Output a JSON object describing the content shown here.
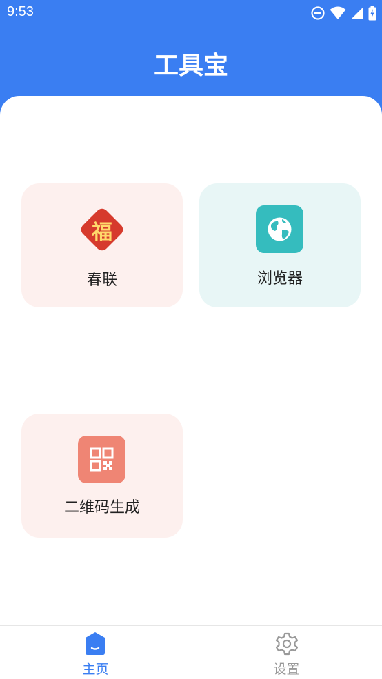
{
  "status_bar": {
    "time": "9:53"
  },
  "header": {
    "title": "工具宝"
  },
  "tools": [
    {
      "label": "春联",
      "icon": "fu-diamond-icon",
      "icon_glyph": "福",
      "card_color": "#fdf0ee",
      "icon_color": "#d63a2c"
    },
    {
      "label": "浏览器",
      "icon": "globe-icon",
      "card_color": "#e8f6f6",
      "icon_color": "#35bcbe"
    },
    {
      "label": "二维码生成",
      "icon": "qr-code-icon",
      "card_color": "#fdf0ee",
      "icon_color": "#ef8574"
    }
  ],
  "bottom_nav": {
    "home": {
      "label": "主页",
      "icon": "home-icon",
      "active": true,
      "color": "#3a7ef2"
    },
    "settings": {
      "label": "设置",
      "icon": "gear-icon",
      "active": false,
      "color": "#999999"
    }
  },
  "colors": {
    "accent": "#3a7ef2",
    "background": "#ffffff"
  }
}
